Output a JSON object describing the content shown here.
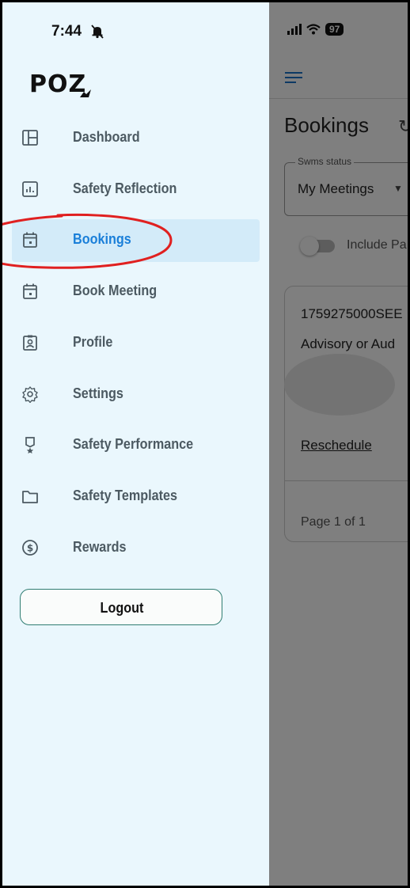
{
  "status_bar": {
    "time": "7:44",
    "battery": "97"
  },
  "drawer": {
    "logo": "POZ",
    "items": [
      {
        "label": "Dashboard",
        "icon": "dashboard-icon",
        "active": false
      },
      {
        "label": "Safety Reflection",
        "icon": "chart-icon",
        "active": false
      },
      {
        "label": "Bookings",
        "icon": "calendar-icon",
        "active": true
      },
      {
        "label": "Book Meeting",
        "icon": "calendar-icon",
        "active": false
      },
      {
        "label": "Profile",
        "icon": "profile-badge-icon",
        "active": false
      },
      {
        "label": "Settings",
        "icon": "gear-icon",
        "active": false
      },
      {
        "label": "Safety Performance",
        "icon": "award-icon",
        "active": false
      },
      {
        "label": "Safety Templates",
        "icon": "folder-icon",
        "active": false
      },
      {
        "label": "Rewards",
        "icon": "dollar-icon",
        "active": false
      }
    ],
    "logout_label": "Logout"
  },
  "background_page": {
    "title": "Bookings",
    "filter": {
      "legend": "Swms status",
      "value": "My Meetings"
    },
    "toggle_label": "Include Pa",
    "card": {
      "id": "1759275000SEE",
      "type": "Advisory or Aud",
      "action": "Reschedule"
    },
    "pagination": "Page 1 of 1"
  },
  "colors": {
    "drawer_bg": "#eaf7fd",
    "active_bg": "#d3ebf9",
    "active_text": "#1a7fd9",
    "logout_border": "#2f7d72",
    "annotation": "#e02020"
  }
}
